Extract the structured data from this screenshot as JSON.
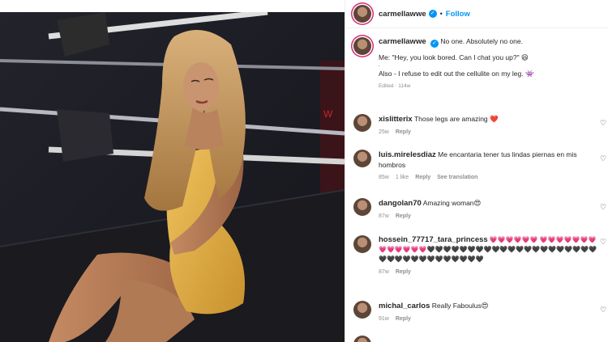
{
  "post": {
    "username": "carmellawwe",
    "follow_label": "Follow",
    "separator": "•",
    "caption_lines": [
      "No one. Absolutely no one.",
      "Me: \"Hey, you look bored. Can I chat you up?\" 😆",
      ".",
      "Also - I refuse to edit out the cellulite on my leg. 👾"
    ],
    "edited": "Edited · 114w"
  },
  "comments": [
    {
      "user": "xislitterix",
      "text": "Those legs are amazing ❤️",
      "time": "25w",
      "likes": "",
      "reply": "Reply",
      "extra": ""
    },
    {
      "user": "luis.mirelesdiaz",
      "text": "Me encantaria tener tus lindas piernas en mis hombros",
      "time": "85w",
      "likes": "1 like",
      "reply": "Reply",
      "extra": "See translation"
    },
    {
      "user": "dangolan70",
      "text": "Amazing woman😍",
      "time": "87w",
      "likes": "",
      "reply": "Reply",
      "extra": ""
    },
    {
      "user": "hossein_77717_tara_princess",
      "text": "💗💗💗💗💗💗 💗💗💗💗💗💗💗💗💗💗💗💗💗🖤🖤🖤🖤🖤🖤🖤🖤🖤🖤🖤🖤🖤🖤🖤🖤🖤🖤🖤🖤🖤🖤🖤🖤🖤🖤🖤🖤🖤🖤🖤🖤🖤🖤",
      "time": "87w",
      "likes": "",
      "reply": "Reply",
      "extra": ""
    },
    {
      "user": "michal_carlos",
      "text": "Really Faboulus😍",
      "time": "91w",
      "likes": "",
      "reply": "Reply",
      "extra": ""
    }
  ],
  "colors": {
    "accent": "#0095f6",
    "dress": "#e2b14a",
    "heart_red": "#ed4956"
  }
}
